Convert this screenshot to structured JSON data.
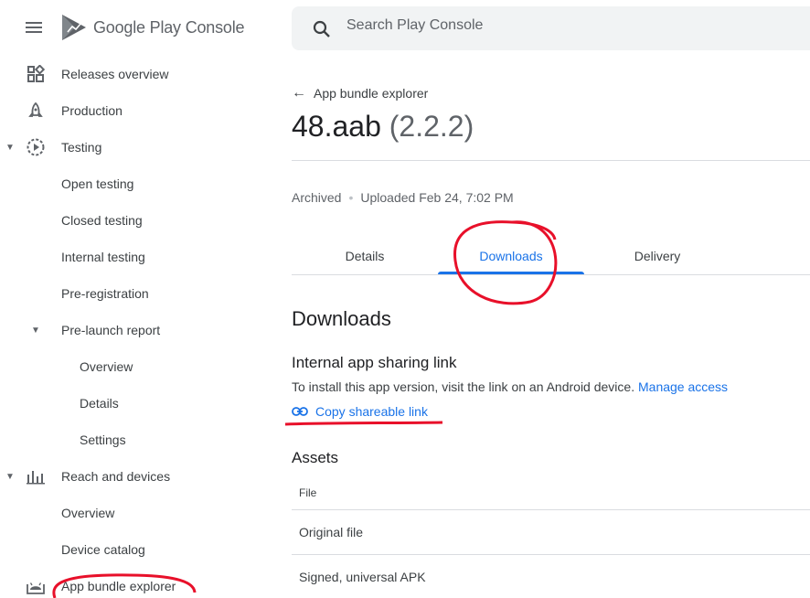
{
  "app": {
    "brand_name": "Google Play",
    "brand_suffix": "Console"
  },
  "search": {
    "placeholder": "Search Play Console"
  },
  "sidebar": {
    "items": [
      {
        "label": "Releases overview"
      },
      {
        "label": "Production"
      },
      {
        "label": "Testing"
      },
      {
        "label": "Open testing"
      },
      {
        "label": "Closed testing"
      },
      {
        "label": "Internal testing"
      },
      {
        "label": "Pre-registration"
      },
      {
        "label": "Pre-launch report"
      },
      {
        "label": "Overview"
      },
      {
        "label": "Details"
      },
      {
        "label": "Settings"
      },
      {
        "label": "Reach and devices"
      },
      {
        "label": "Overview"
      },
      {
        "label": "Device catalog"
      },
      {
        "label": "App bundle explorer"
      }
    ]
  },
  "main": {
    "back_label": "App bundle explorer",
    "title": "48.aab",
    "version": "(2.2.2)",
    "status": "Archived",
    "uploaded": "Uploaded Feb 24, 7:02 PM",
    "tabs": [
      {
        "label": "Details"
      },
      {
        "label": "Downloads"
      },
      {
        "label": "Delivery"
      }
    ],
    "section_title": "Downloads",
    "sharing": {
      "title": "Internal app sharing link",
      "help": "To install this app version, visit the link on an Android device.",
      "manage_access": "Manage access",
      "copy_label": "Copy shareable link"
    },
    "assets": {
      "title": "Assets",
      "column_file": "File",
      "rows": [
        {
          "file": "Original file"
        },
        {
          "file": "Signed, universal APK"
        }
      ]
    }
  },
  "colors": {
    "accent": "#1a73e8",
    "annotation": "#e8102a"
  }
}
